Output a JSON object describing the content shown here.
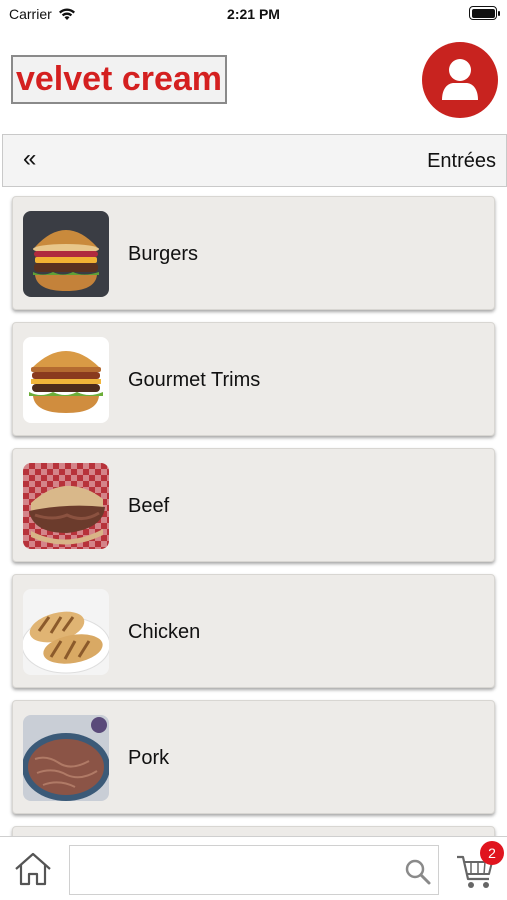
{
  "status_bar": {
    "carrier": "Carrier",
    "time": "2:21 PM"
  },
  "brand": {
    "logo_text": "velvet  cream",
    "accent_color": "#c8231f"
  },
  "subnav": {
    "back_glyph": "«",
    "title": "Entrées"
  },
  "categories": [
    {
      "label": "Burgers",
      "icon": "burger-photo"
    },
    {
      "label": "Gourmet Trims",
      "icon": "gourmet-burger-photo"
    },
    {
      "label": "Beef",
      "icon": "beef-sandwich-photo"
    },
    {
      "label": "Chicken",
      "icon": "grilled-chicken-photo"
    },
    {
      "label": "Pork",
      "icon": "pulled-pork-photo"
    }
  ],
  "bottom_bar": {
    "search_placeholder": "",
    "cart_count": "2"
  }
}
